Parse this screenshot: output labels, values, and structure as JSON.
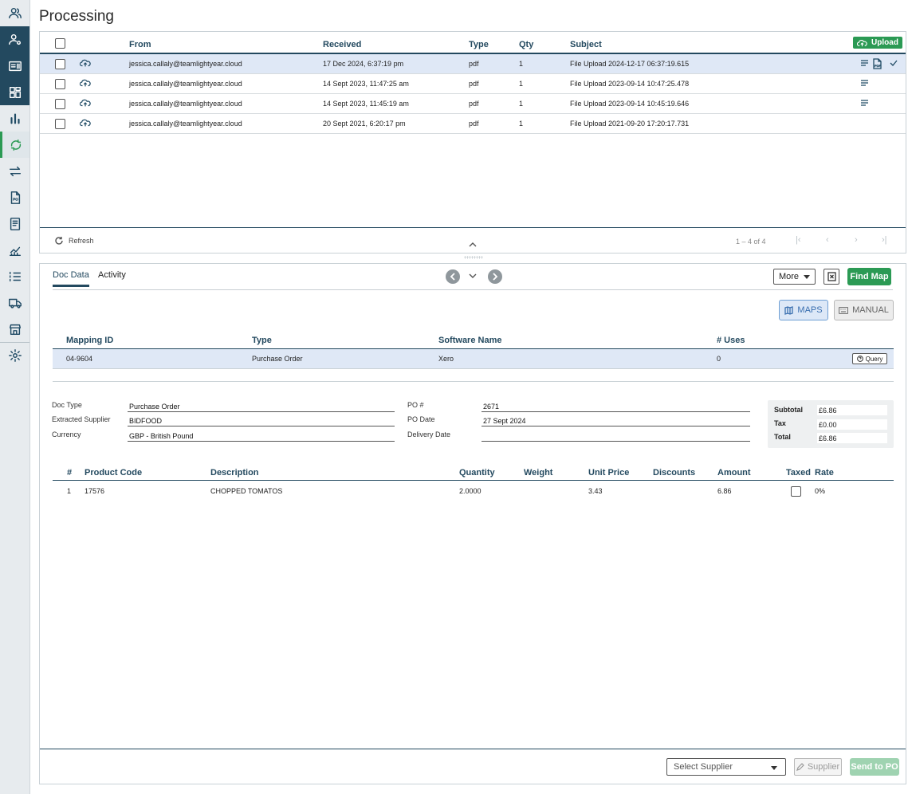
{
  "page": {
    "title": "Processing"
  },
  "sidebar": {
    "items": [
      {
        "icon": "users-icon"
      },
      {
        "icon": "user-settings-icon"
      },
      {
        "icon": "id-card-icon"
      },
      {
        "icon": "dashboard-grid-icon"
      },
      {
        "icon": "bar-chart-icon"
      },
      {
        "icon": "sync-icon"
      },
      {
        "icon": "transfer-icon"
      },
      {
        "icon": "po-document-icon"
      },
      {
        "icon": "invoice-icon"
      },
      {
        "icon": "line-chart-icon"
      },
      {
        "icon": "list-icon"
      },
      {
        "icon": "truck-icon"
      },
      {
        "icon": "store-icon"
      },
      {
        "icon": "settings-gear-icon"
      }
    ]
  },
  "grid": {
    "headers": {
      "from": "From",
      "received": "Received",
      "type": "Type",
      "qty": "Qty",
      "subject": "Subject"
    },
    "upload_label": "Upload",
    "rows": [
      {
        "from": "jessica.callaly@teamlightyear.cloud",
        "received": "17 Dec 2024, 6:37:19 pm",
        "type": "pdf",
        "qty": "1",
        "subject": "File Upload 2024-12-17 06:37:19.615"
      },
      {
        "from": "jessica.callaly@teamlightyear.cloud",
        "received": "14 Sept 2023, 11:47:25 am",
        "type": "pdf",
        "qty": "1",
        "subject": "File Upload 2023-09-14 10:47:25.478"
      },
      {
        "from": "jessica.callaly@teamlightyear.cloud",
        "received": "14 Sept 2023, 11:45:19 am",
        "type": "pdf",
        "qty": "1",
        "subject": "File Upload 2023-09-14 10:45:19.646"
      },
      {
        "from": "jessica.callaly@teamlightyear.cloud",
        "received": "20 Sept 2021, 6:20:17 pm",
        "type": "pdf",
        "qty": "1",
        "subject": "File Upload 2021-09-20 17:20:17.731"
      }
    ],
    "footer": {
      "refresh_label": "Refresh",
      "page_info": "1 – 4 of 4"
    }
  },
  "detail": {
    "tabs": [
      "Doc Data",
      "Activity"
    ],
    "more_label": "More",
    "find_map_label": "Find Map",
    "maps_label": "MAPS",
    "manual_label": "MANUAL",
    "mapping": {
      "headers": {
        "id": "Mapping ID",
        "type": "Type",
        "software": "Software Name",
        "uses": "# Uses"
      },
      "row": {
        "id": "04-9604",
        "type": "Purchase Order",
        "software": "Xero",
        "uses": "0"
      },
      "query_label": "Query"
    },
    "doc": {
      "doc_type_label": "Doc Type",
      "doc_type": "Purchase Order",
      "supplier_label": "Extracted Supplier",
      "supplier": "BIDFOOD",
      "currency_label": "Currency",
      "currency": "GBP - British Pound",
      "po_label": "PO #",
      "po": "2671",
      "po_date_label": "PO Date",
      "po_date": "27 Sept 2024",
      "delivery_label": "Delivery Date",
      "delivery": ""
    },
    "totals": {
      "subtotal_label": "Subtotal",
      "subtotal": "£6.86",
      "tax_label": "Tax",
      "tax": "£0.00",
      "total_label": "Total",
      "total": "£6.86"
    },
    "items": {
      "headers": {
        "num": "#",
        "code": "Product Code",
        "desc": "Description",
        "qty": "Quantity",
        "weight": "Weight",
        "unit": "Unit Price",
        "discounts": "Discounts",
        "amount": "Amount",
        "taxed": "Taxed",
        "rate": "Rate"
      },
      "rows": [
        {
          "num": "1",
          "code": "17576",
          "desc": "CHOPPED TOMATOS",
          "qty": "2.0000",
          "weight": "",
          "unit": "3.43",
          "discounts": "",
          "amount": "6.86",
          "rate": "0%"
        }
      ]
    },
    "footer": {
      "select_supplier_placeholder": "Select Supplier",
      "supplier_label": "Supplier",
      "send_po_label": "Send to PO"
    }
  }
}
